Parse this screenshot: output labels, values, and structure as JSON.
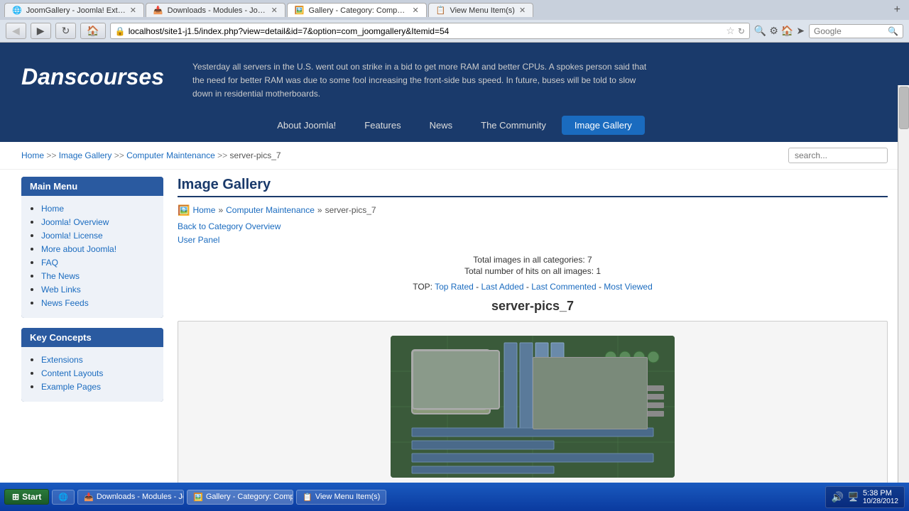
{
  "browser": {
    "tabs": [
      {
        "id": "tab1",
        "label": "JoomGallery - Joomla! Extensions Directory",
        "active": false,
        "icon": "🌐"
      },
      {
        "id": "tab2",
        "label": "Downloads - Modules - JoomImages",
        "active": false,
        "icon": "📥"
      },
      {
        "id": "tab3",
        "label": "Gallery - Category: Computer Maintenan...",
        "active": true,
        "icon": "🖼️"
      },
      {
        "id": "tab4",
        "label": "View Menu Item(s)",
        "active": false,
        "icon": "📋"
      }
    ],
    "address": "localhost/site1-j1.5/index.php?view=detail&id=7&option=com_joomgallery&Itemid=54",
    "search_placeholder": "Google"
  },
  "header": {
    "logo": "Danscourses",
    "news_text": "Yesterday all servers in the U.S. went out on strike in a bid to get more RAM and better CPUs. A spokes person said that the need for better RAM was due to some fool increasing the front-side bus speed. In future, buses will be told to slow down in residential motherboards."
  },
  "nav": {
    "items": [
      {
        "label": "About Joomla!",
        "active": false
      },
      {
        "label": "Features",
        "active": false
      },
      {
        "label": "News",
        "active": false
      },
      {
        "label": "The Community",
        "active": false
      },
      {
        "label": "Image Gallery",
        "active": true
      }
    ]
  },
  "breadcrumb": {
    "items": [
      {
        "label": "Home",
        "href": "#"
      },
      {
        "label": "Image Gallery",
        "href": "#"
      },
      {
        "label": "Computer Maintenance",
        "href": "#"
      },
      {
        "label": "server-pics_7",
        "href": ""
      }
    ],
    "search_placeholder": "search..."
  },
  "sidebar": {
    "main_menu": {
      "title": "Main Menu",
      "items": [
        {
          "label": "Home"
        },
        {
          "label": "Joomla! Overview"
        },
        {
          "label": "Joomla! License"
        },
        {
          "label": "More about Joomla!"
        },
        {
          "label": "FAQ"
        },
        {
          "label": "The News"
        },
        {
          "label": "Web Links"
        },
        {
          "label": "News Feeds"
        }
      ]
    },
    "key_concepts": {
      "title": "Key Concepts",
      "items": [
        {
          "label": "Extensions"
        },
        {
          "label": "Content Layouts"
        },
        {
          "label": "Example Pages"
        }
      ]
    }
  },
  "content": {
    "title": "Image Gallery",
    "breadcrumb_icon": "🖼️",
    "breadcrumb_home": "Home",
    "breadcrumb_category": "Computer Maintenance",
    "breadcrumb_sub": "server-pics_7",
    "back_link": "Back to Category Overview",
    "user_panel": "User Panel",
    "stats": {
      "total_images": "Total images in all categories: 7",
      "total_hits": "Total number of hits on all images: 1"
    },
    "top_label": "TOP:",
    "top_links": [
      {
        "label": "Top Rated"
      },
      {
        "label": "Last Added"
      },
      {
        "label": "Last Commented"
      },
      {
        "label": "Most Viewed"
      }
    ],
    "top_sep": " - ",
    "category_title": "server-pics_7"
  },
  "taskbar": {
    "start_label": "Start",
    "items": [
      {
        "label": "IE",
        "icon": "🌐"
      },
      {
        "label": "Downloads - Modules - JoomImages",
        "icon": "📥",
        "active": false
      },
      {
        "label": "Gallery - Category: Computer...",
        "icon": "🖼️",
        "active": true
      },
      {
        "label": "View Menu Item(s)",
        "icon": "📋",
        "active": false
      }
    ],
    "tray": {
      "time": "5:38 PM",
      "date": "10/28/2012"
    }
  }
}
